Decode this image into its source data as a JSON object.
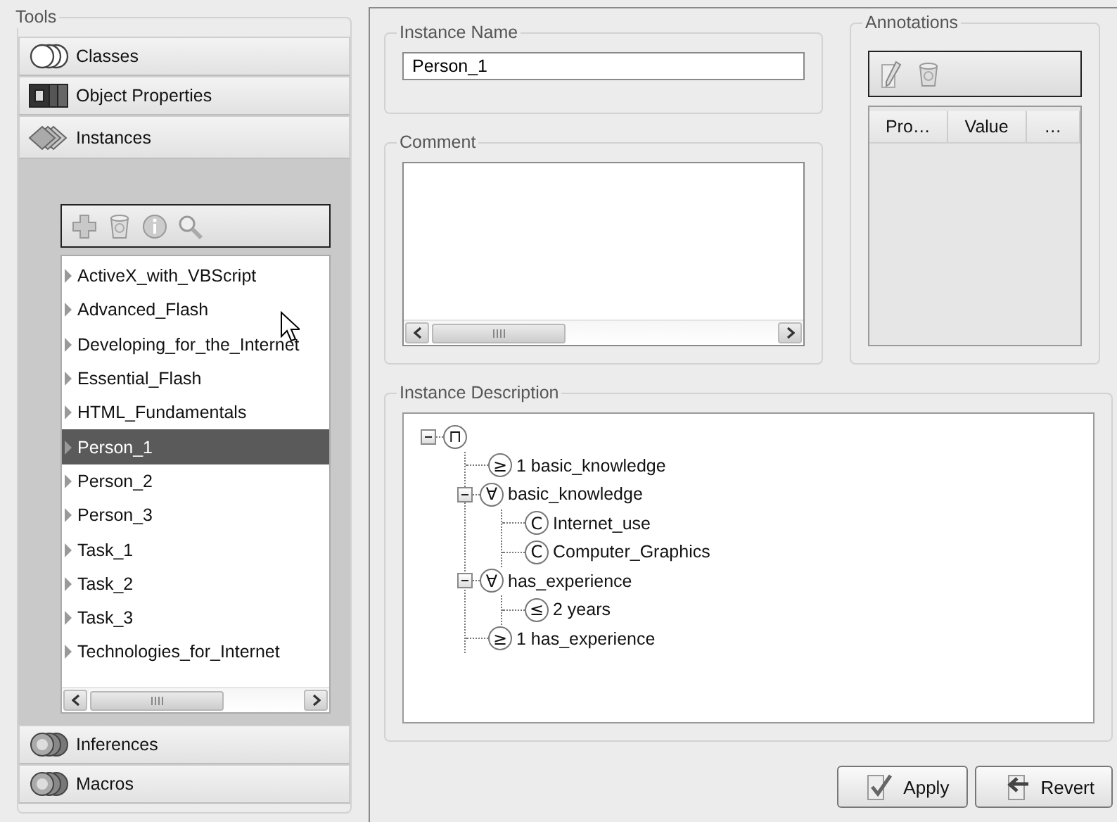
{
  "tools": {
    "title": "Tools",
    "sections": [
      {
        "label": "Classes",
        "selected": false
      },
      {
        "label": "Object Properties",
        "selected": false
      },
      {
        "label": "Instances",
        "selected": true
      },
      {
        "label": "Inferences",
        "selected": false
      },
      {
        "label": "Macros",
        "selected": false
      }
    ],
    "instances": [
      {
        "label": "ActiveX_with_VBScript",
        "selected": false
      },
      {
        "label": "Advanced_Flash",
        "selected": false
      },
      {
        "label": "Developing_for_the_Internet",
        "selected": false
      },
      {
        "label": "Essential_Flash",
        "selected": false
      },
      {
        "label": "HTML_Fundamentals",
        "selected": false
      },
      {
        "label": "Person_1",
        "selected": true
      },
      {
        "label": "Person_2",
        "selected": false
      },
      {
        "label": "Person_3",
        "selected": false
      },
      {
        "label": "Task_1",
        "selected": false
      },
      {
        "label": "Task_2",
        "selected": false
      },
      {
        "label": "Task_3",
        "selected": false
      },
      {
        "label": "Technologies_for_Internet",
        "selected": false
      }
    ]
  },
  "instance_name": {
    "title": "Instance Name",
    "value": "Person_1"
  },
  "comment": {
    "title": "Comment"
  },
  "annotations": {
    "title": "Annotations",
    "columns": [
      "Pro…",
      "Value",
      "…"
    ]
  },
  "instance_description": {
    "title": "Instance Description",
    "tree": [
      {
        "symbol": "⊓",
        "expanded": true,
        "children": [
          {
            "symbol": "≥",
            "text": "1 basic_knowledge"
          },
          {
            "symbol": "∀",
            "text": "basic_knowledge",
            "expanded": true,
            "children": [
              {
                "symbol": "C",
                "text": "Internet_use"
              },
              {
                "symbol": "C",
                "text": "Computer_Graphics"
              }
            ]
          },
          {
            "symbol": "∀",
            "text": "has_experience",
            "expanded": true,
            "children": [
              {
                "symbol": "≤",
                "text": "2 years"
              }
            ]
          },
          {
            "symbol": "≥",
            "text": "1 has_experience"
          }
        ]
      }
    ]
  },
  "buttons": [
    {
      "label": "Apply"
    },
    {
      "label": "Revert"
    }
  ]
}
